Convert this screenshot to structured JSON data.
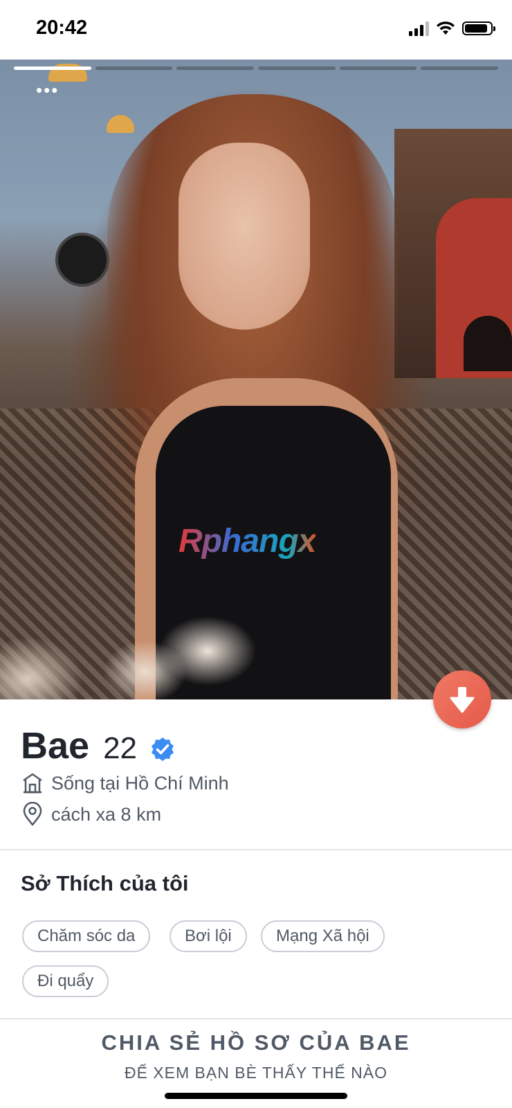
{
  "status_bar": {
    "time": "20:42"
  },
  "photo": {
    "watermark": "Rphangx",
    "progress_segments": 6,
    "active_segment": 1
  },
  "profile": {
    "name": "Bae",
    "age": "22",
    "verified": true,
    "lives_in": "Sống tại Hồ Chí Minh",
    "distance": "cách xa 8 km"
  },
  "interests": {
    "title": "Sở Thích của tôi",
    "items": [
      "Chăm sóc da",
      "Bơi lội",
      "Mạng Xã hội",
      "Đi quẩy"
    ]
  },
  "share": {
    "title": "CHIA SẺ HỒ SƠ CỦA BAE",
    "subtitle": "ĐỂ XEM BẠN BÈ THẤY THẾ NÀO"
  },
  "colors": {
    "accent": "#ec6552",
    "verified_blue": "#3b8cf3",
    "text_dark": "#21262e",
    "text_muted": "#505965"
  },
  "icons": {
    "home": "home-icon",
    "location": "location-pin-icon",
    "collapse": "arrow-down-icon",
    "verified": "verified-badge-icon"
  }
}
